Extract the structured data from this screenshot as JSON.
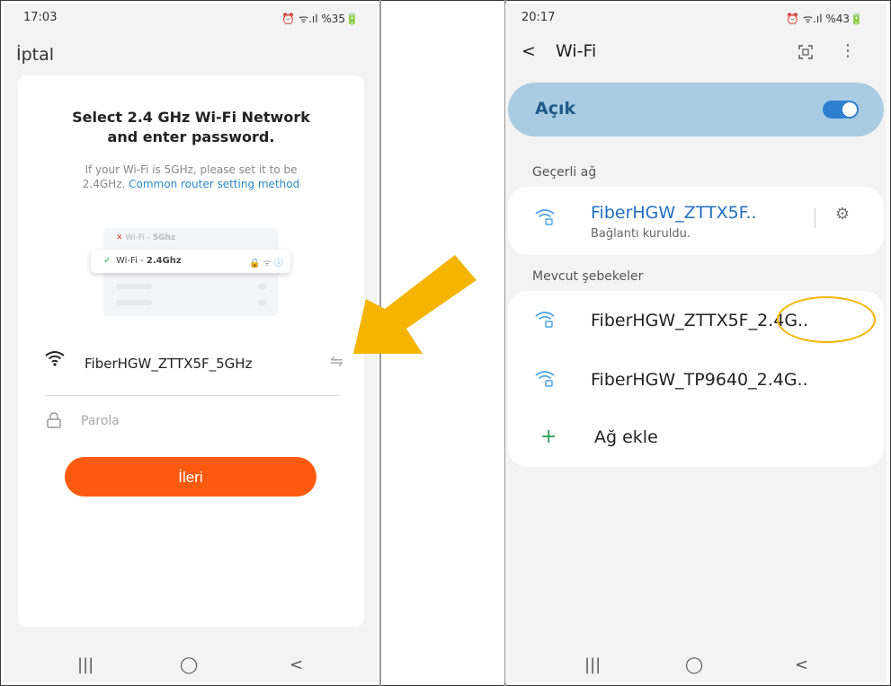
{
  "left_phone": {
    "status_time": "17:03",
    "status_icons": "⏰ ᯤ.ıl %35🔋",
    "cancel_label": "İptal",
    "title_line1": "Select 2.4 GHz Wi-Fi Network",
    "title_line2": "and enter password.",
    "subtitle_line1": "If your Wi-Fi is 5GHz, please set it to be",
    "subtitle_prefix": "2.4GHz.",
    "subtitle_link": "Common router setting method",
    "illustration": {
      "row_5ghz_prefix": "Wi-Fi - ",
      "row_5ghz_band": "5Ghz",
      "row_24_prefix": "Wi-Fi - ",
      "row_24_band": "2.4Ghz"
    },
    "network_name": "FiberHGW_ZTTX5F_5GHz",
    "password_placeholder": "Parola",
    "next_button": "İleri",
    "nav": {
      "recent": "|||",
      "home": "◯",
      "back": "<"
    }
  },
  "right_phone": {
    "status_time": "20:17",
    "status_icons": "⏰ ᯤ.ıl %43🔋",
    "header_back": "<",
    "header_title": "Wi-Fi",
    "wifi_toggle_label": "Açık",
    "wifi_toggle_on": true,
    "current_section": "Geçerli ağ",
    "current_network": "FiberHGW_ZTTX5F..",
    "current_status": "Bağlantı kuruldu.",
    "available_section": "Mevcut şebekeler",
    "networks": [
      "FiberHGW_ZTTX5F_2.4G..",
      "FiberHGW_TP9640_2.4G.."
    ],
    "add_network": "Ağ ekle",
    "nav": {
      "recent": "|||",
      "home": "◯",
      "back": "<"
    }
  },
  "colors": {
    "primary_button": "#ff5a0f",
    "link": "#2d8ac8",
    "toggle_bg": "#a9cce3",
    "toggle_switch": "#2f7fd1",
    "annotation_arrow": "#f4b400",
    "highlight_ellipse": "#f4b400"
  },
  "icons": [
    "wifi-icon",
    "swap-icon",
    "lock-icon",
    "gear-icon",
    "qr-scan-icon",
    "more-vert-icon",
    "plus-icon",
    "arrow-annotation"
  ]
}
